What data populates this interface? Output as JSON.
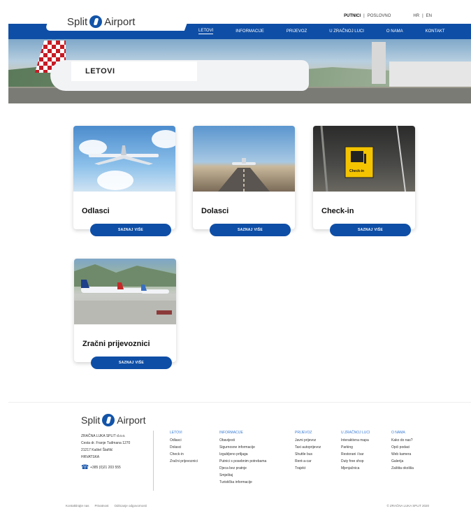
{
  "brand": {
    "name_left": "Split",
    "name_right": "Airport"
  },
  "utility": {
    "passengers": "PUTNICI",
    "business": "POSLOVNO",
    "lang_hr": "HR",
    "lang_en": "EN"
  },
  "nav": {
    "items": [
      "LETOVI",
      "INFORMACIJE",
      "PRIJEVOZ",
      "U ZRAČNOJ LUCI",
      "O NAMA",
      "KONTAKT"
    ]
  },
  "hero": {
    "title": "LETOVI"
  },
  "cards": [
    {
      "title": "Odlasci",
      "button": "SAZNAJ VIŠE"
    },
    {
      "title": "Dolasci",
      "button": "SAZNAJ VIŠE"
    },
    {
      "title": "Check-in",
      "button": "SAZNAJ VIŠE",
      "sign": "Check-in"
    },
    {
      "title": "Zračni prijevoznici",
      "button": "SAZNAJ VIŠE"
    }
  ],
  "footer": {
    "address": [
      "ZRAČNA LUKA SPLIT d.o.o.",
      "Cesta dr. Franje Tuđmana 1270",
      "21217 Kaštel Štafilić",
      "HRVATSKA"
    ],
    "phone": "+385 (0)21 203 555",
    "columns": [
      {
        "heading": "LETOVI",
        "items": [
          "Odlasci",
          "Dolasci",
          "Check-in",
          "Zračni prijevoznici"
        ]
      },
      {
        "heading": "INFORMACIJE",
        "items": [
          "Obavijesti",
          "Sigurnosne informacije",
          "Izgubljeno prtljaga",
          "Putnici s posebnim potrebama",
          "Djeca bez pratnje",
          "Smještaj",
          "Turistička informacije"
        ]
      },
      {
        "heading": "PRIJEVOZ",
        "items": [
          "Javni prijevoz",
          "Taxi autoprijevoz",
          "Shuttle bus",
          "Rent-a-car",
          "Trajekt"
        ]
      },
      {
        "heading": "U ZRAČNOJ LUCI",
        "items": [
          "Interaktivna mapa",
          "Parking",
          "Restorani i bar",
          "Duty free shop",
          "Mjenjačnica"
        ]
      },
      {
        "heading": "O NAMA",
        "items": [
          "Kako do nas?",
          "Opći podaci",
          "Web kamera",
          "Galerija",
          "Zaštita okoliša"
        ]
      }
    ]
  },
  "bottom": {
    "links": [
      "Kontaktirajte nas",
      "Privatnost",
      "Odricanje odgovornosti"
    ],
    "copyright": "© ZRAČNA LUKA SPLIT 2020"
  },
  "colors": {
    "brand_blue": "#0e4ea6",
    "footer_heading": "#3a7bd5"
  }
}
